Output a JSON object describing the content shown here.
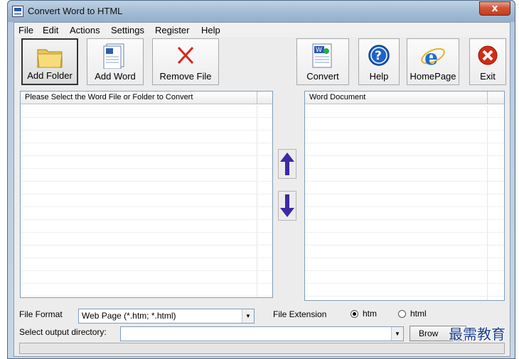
{
  "window": {
    "title": "Convert Word to HTML",
    "close_label": "x"
  },
  "menu": [
    "File",
    "Edit",
    "Actions",
    "Settings",
    "Register",
    "Help"
  ],
  "toolbar": {
    "add_folder": "Add Folder",
    "add_word": "Add Word",
    "remove_file": "Remove File",
    "convert": "Convert",
    "help": "Help",
    "homepage": "HomePage",
    "exit": "Exit"
  },
  "icons": {
    "add_folder": "folder-icon",
    "add_word": "word-document-icon",
    "remove_file": "red-x-icon",
    "convert": "word-convert-icon",
    "help": "question-icon",
    "homepage": "internet-explorer-icon",
    "exit": "exit-icon",
    "move_up": "arrow-up-icon",
    "move_down": "arrow-down-icon"
  },
  "left_panel": {
    "header": "Please Select the Word File or Folder to Convert"
  },
  "right_panel": {
    "header": "Word Document"
  },
  "bottom": {
    "file_format_label": "File Format",
    "file_format_value": "Web Page (*.htm; *.html)",
    "file_extension_label": "File Extension",
    "ext_htm": "htm",
    "ext_html": "html",
    "selected_extension": "htm",
    "output_dir_label": "Select  output directory:",
    "output_dir_value": "",
    "browse_label": "Brow"
  },
  "watermark": "最需教育",
  "colors": {
    "arrow": "#3b2aa6",
    "exit_red": "#d32b16",
    "help_blue": "#1f63c8",
    "ie_blue": "#1b6fd1"
  }
}
